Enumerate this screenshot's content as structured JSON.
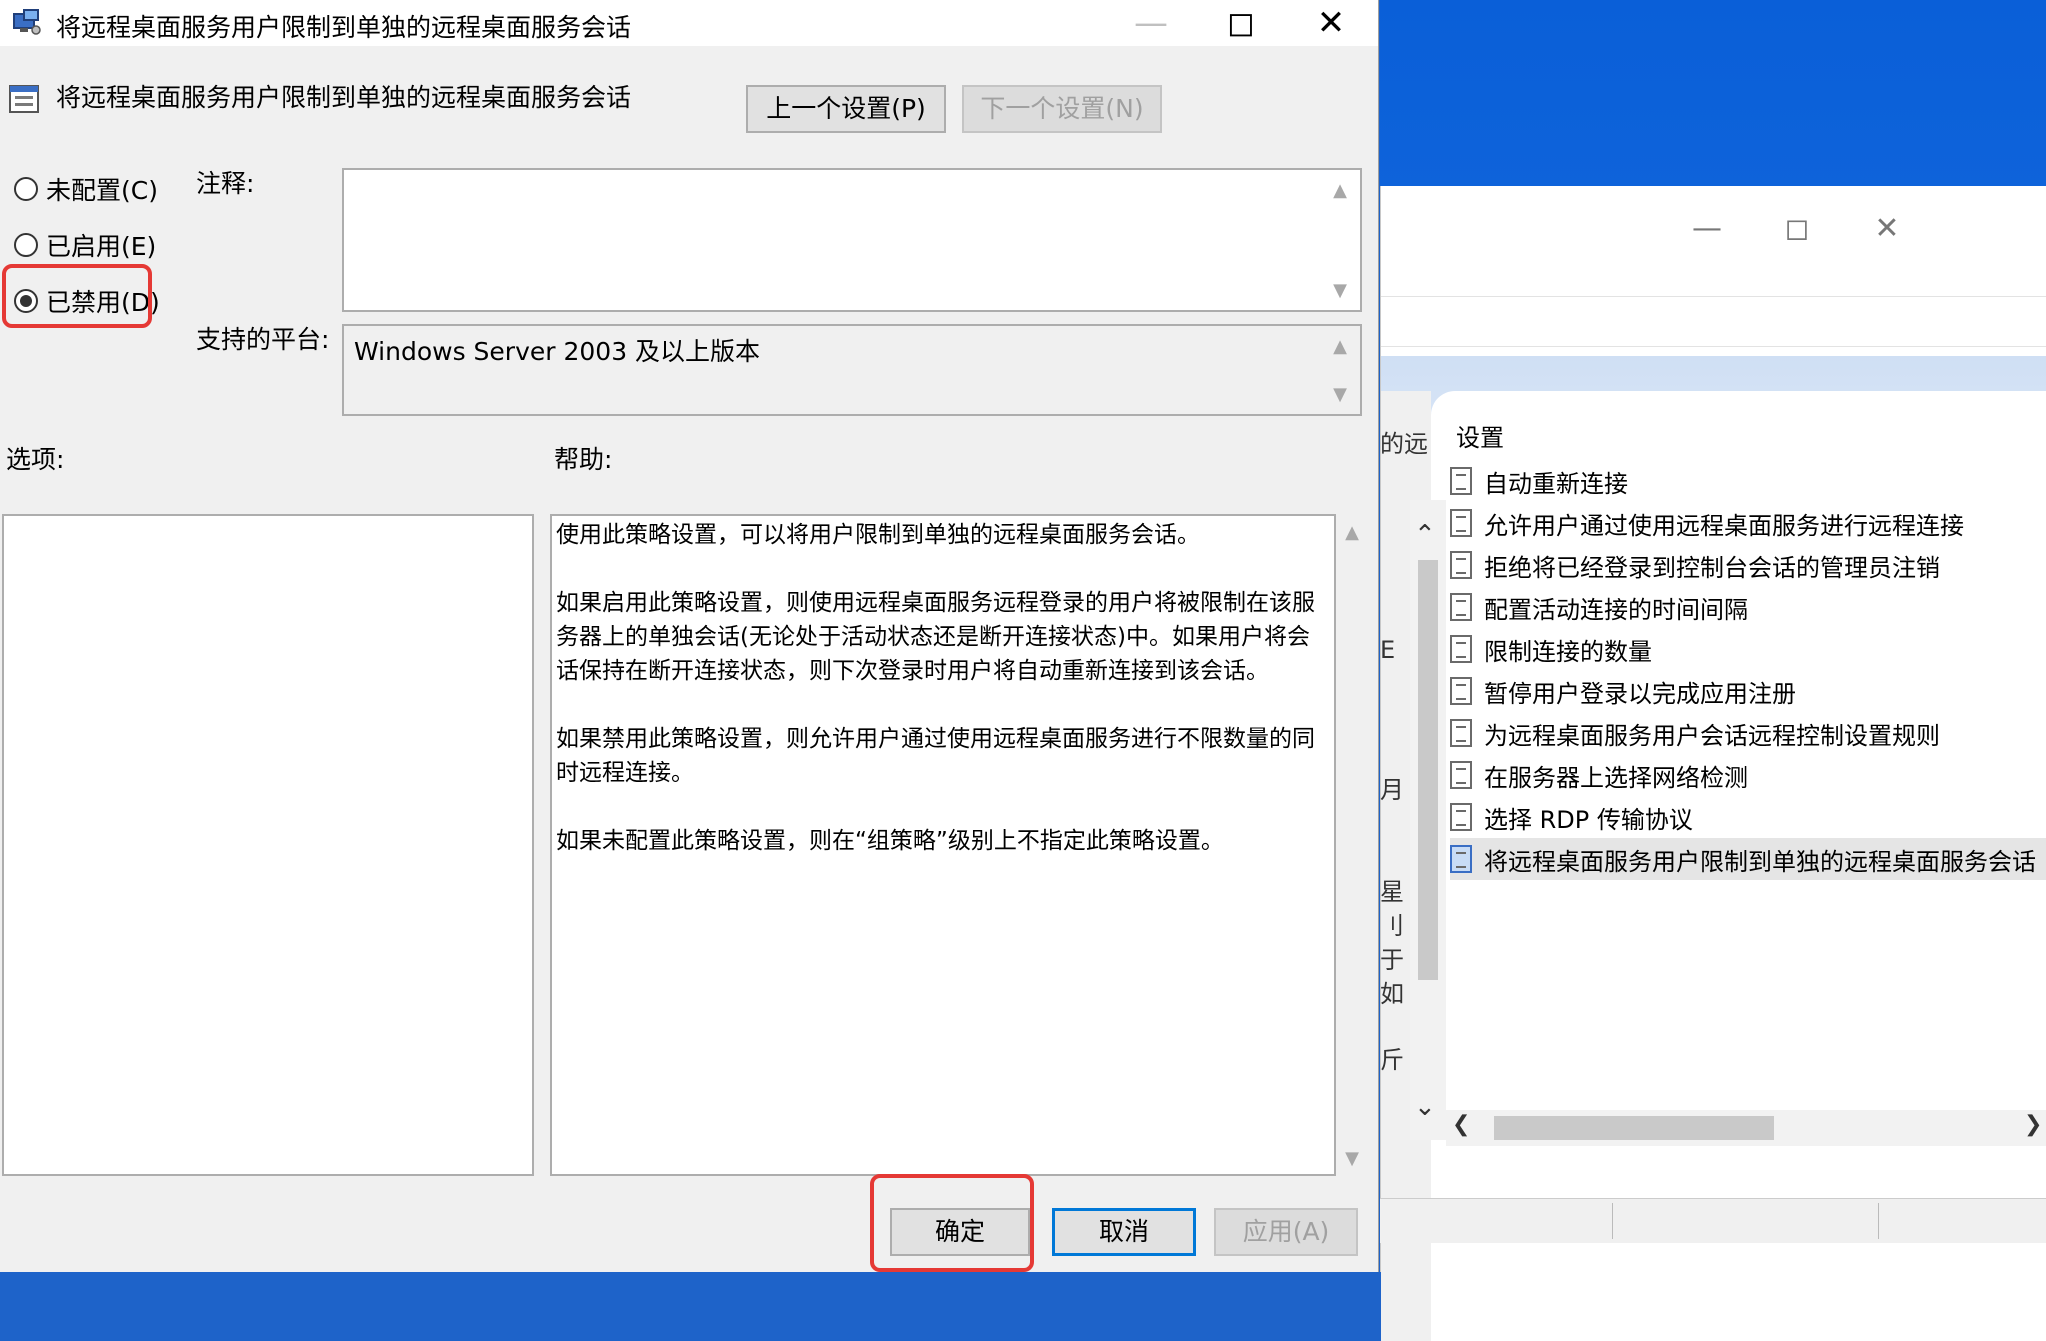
{
  "dialog": {
    "title": "将远程桌面服务用户限制到单独的远程桌面服务会话",
    "header_title": "将远程桌面服务用户限制到单独的远程桌面服务会话",
    "prev_button": "上一个设置(P)",
    "next_button": "下一个设置(N)",
    "radios": [
      {
        "label": "未配置(C)",
        "checked": false
      },
      {
        "label": "已启用(E)",
        "checked": false
      },
      {
        "label": "已禁用(D)",
        "checked": true
      }
    ],
    "comment_label": "注释:",
    "comment_value": "",
    "platform_label": "支持的平台:",
    "platform_value": "Windows Server 2003 及以上版本",
    "options_label": "选项:",
    "help_label": "帮助:",
    "help_paragraphs": [
      "使用此策略设置，可以将用户限制到单独的远程桌面服务会话。",
      "如果启用此策略设置，则使用远程桌面服务远程登录的用户将被限制在该服务器上的单独会话(无论处于活动状态还是断开连接状态)中。如果用户将会话保持在断开连接状态，则下次登录时用户将自动重新连接到该会话。",
      "如果禁用此策略设置，则允许用户通过使用远程桌面服务进行不限数量的同时远程连接。",
      "如果未配置此策略设置，则在“组策略”级别上不指定此策略设置。"
    ],
    "ok_button": "确定",
    "cancel_button": "取消",
    "apply_button": "应用(A)"
  },
  "background_window": {
    "partial_left_text": [
      "的远",
      "E",
      "月",
      "星",
      "刂",
      "于",
      "如",
      "斤"
    ],
    "settings_header": "设置",
    "items": [
      {
        "label": "自动重新连接",
        "selected": false
      },
      {
        "label": "允许用户通过使用远程桌面服务进行远程连接",
        "selected": false
      },
      {
        "label": "拒绝将已经登录到控制台会话的管理员注销",
        "selected": false
      },
      {
        "label": "配置活动连接的时间间隔",
        "selected": false
      },
      {
        "label": "限制连接的数量",
        "selected": false
      },
      {
        "label": "暂停用户登录以完成应用注册",
        "selected": false
      },
      {
        "label": "为远程桌面服务用户会话远程控制设置规则",
        "selected": false
      },
      {
        "label": "在服务器上选择网络检测",
        "selected": false
      },
      {
        "label": "选择 RDP 传输协议",
        "selected": false
      },
      {
        "label": "将远程桌面服务用户限制到单独的远程桌面服务会话",
        "selected": true
      }
    ]
  },
  "colors": {
    "highlight_red": "#e53935",
    "default_button_blue": "#0078d7",
    "desktop_blue": "#1a6fe0"
  }
}
